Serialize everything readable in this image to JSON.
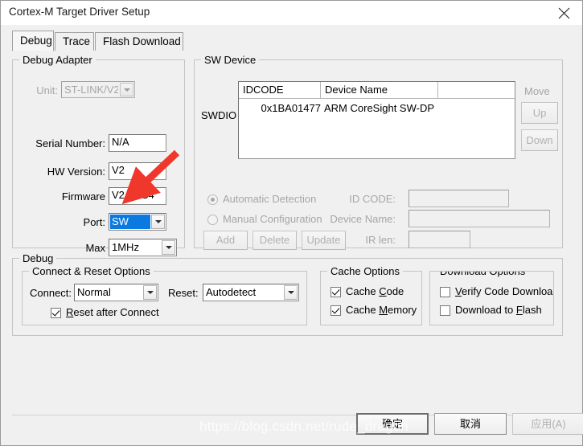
{
  "window": {
    "title": "Cortex-M Target Driver Setup",
    "close_icon": "close-icon"
  },
  "tabs": [
    {
      "label": "Debug",
      "active": true
    },
    {
      "label": "Trace",
      "active": false
    },
    {
      "label": "Flash Download",
      "active": false
    }
  ],
  "debug_adapter": {
    "legend": "Debug Adapter",
    "unit": {
      "label": "Unit:",
      "value": "ST-LINK/V2",
      "disabled": true
    },
    "serial_number": {
      "label": "Serial Number:",
      "value": "N/A"
    },
    "hw_version": {
      "label": "HW Version:",
      "value": "V2"
    },
    "firmware": {
      "label": "Firmware",
      "value": "V2J16S4"
    },
    "port": {
      "label": "Port:",
      "value": "SW",
      "selected": true,
      "selection_color": "#0a7ae0"
    },
    "max": {
      "label": "Max",
      "value": "1MHz"
    }
  },
  "sw_device": {
    "legend": "SW Device",
    "bus_label": "SWDIO",
    "columns": [
      "IDCODE",
      "Device Name",
      ""
    ],
    "rows": [
      {
        "idcode": "0x1BA01477",
        "device_name": "ARM CoreSight SW-DP",
        "extra": ""
      }
    ],
    "move_label": "Move",
    "up_label": "Up",
    "down_label": "Down",
    "automatic_detection": {
      "label": "Automatic Detection",
      "checked": true,
      "disabled": true
    },
    "manual_configuration": {
      "label": "Manual Configuration",
      "checked": false,
      "disabled": true
    },
    "id_code": {
      "label": "ID CODE:",
      "value": ""
    },
    "device_name": {
      "label": "Device Name:",
      "value": ""
    },
    "ir_len": {
      "label": "IR len:",
      "value": ""
    },
    "add_label": "Add",
    "delete_label": "Delete",
    "update_label": "Update"
  },
  "debug": {
    "legend": "Debug",
    "connect_reset": {
      "legend": "Connect & Reset Options",
      "connect_label": "Connect:",
      "connect_value": "Normal",
      "reset_label": "Reset:",
      "reset_value": "Autodetect",
      "reset_after_connect": {
        "prefix": "",
        "accel": "R",
        "suffix": "eset after Connect",
        "checked": true
      }
    },
    "cache": {
      "legend": "Cache Options",
      "cache_code": {
        "prefix": "Cache ",
        "accel": "C",
        "suffix": "ode",
        "checked": true
      },
      "cache_memory": {
        "prefix": "Cache ",
        "accel": "M",
        "suffix": "emory",
        "checked": true
      }
    },
    "download": {
      "legend": "Download Options",
      "verify_code_download": {
        "prefix": "",
        "accel": "V",
        "suffix": "erify Code Download",
        "checked": false
      },
      "download_to_flash": {
        "prefix": "Download to ",
        "accel": "F",
        "suffix": "lash",
        "checked": false
      }
    }
  },
  "footer": {
    "ok_label": "确定",
    "cancel_label": "取消",
    "apply_label": "应用(A)",
    "apply_disabled": true
  },
  "watermark": {
    "text": "https://blog.csdn.net/rude_dragon"
  },
  "annotation": {
    "arrow_color": "#f0372b"
  }
}
